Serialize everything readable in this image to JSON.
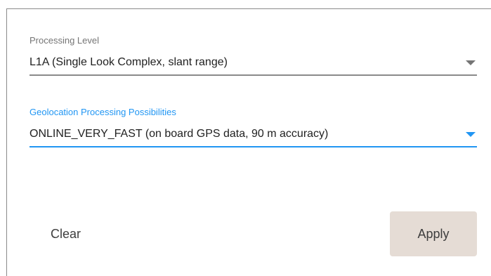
{
  "processing_level": {
    "label": "Processing Level",
    "value": "L1A (Single Look Complex, slant range)",
    "arrow_icon": "triangle-down-icon"
  },
  "geolocation": {
    "label": "Geolocation Processing Possibilities",
    "value": "ONLINE_VERY_FAST (on board GPS data, 90 m accuracy)",
    "arrow_icon": "triangle-down-icon",
    "focus_color": "#2196f3"
  },
  "actions": {
    "clear_label": "Clear",
    "apply_label": "Apply",
    "apply_bg": "#e5dcd5"
  }
}
